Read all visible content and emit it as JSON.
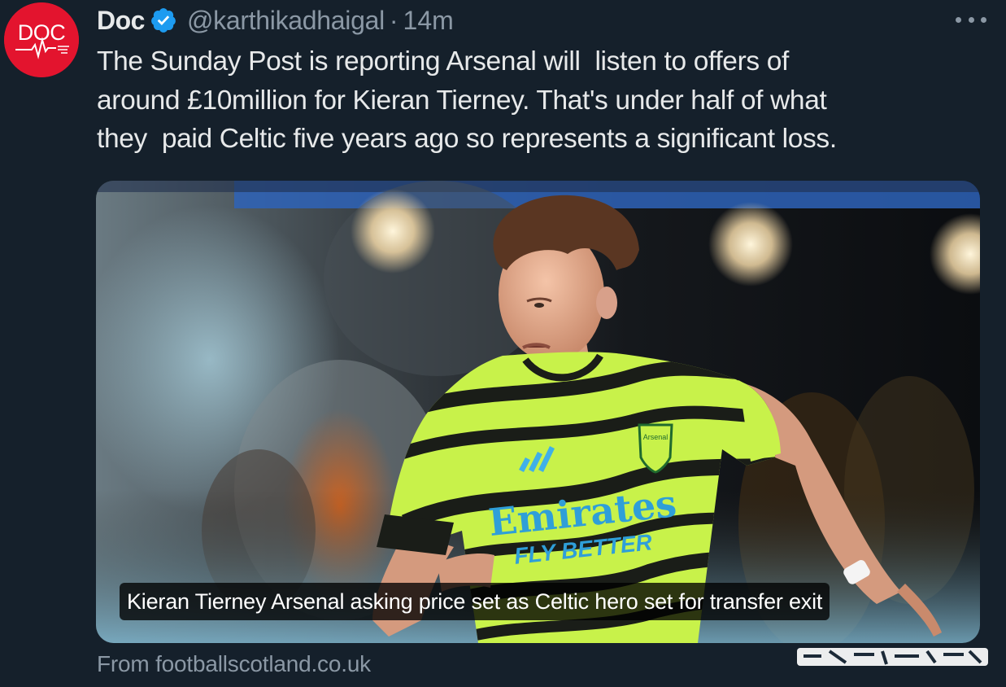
{
  "tweet": {
    "avatar": {
      "label": "DOC",
      "icon": "doc-logo-heartbeat-icon",
      "color": "#e3142e"
    },
    "author_name": "Doc",
    "verified_icon": "verified-badge-icon",
    "handle": "@karthikadhaigal",
    "separator": "·",
    "time": "14m",
    "more_icon": "more-options-icon",
    "text": "The Sunday Post is reporting Arsenal will  listen to offers of\naround £10million for Kieran Tierney. That's under half of what\nthey  paid Celtic five years ago so represents a significant loss.",
    "card": {
      "image": "footballer-in-arsenal-away-kit-photo",
      "shirt_sponsor": "Emirates",
      "shirt_tagline": "FLY BETTER",
      "crest_text": "Arsenal",
      "caption": "Kieran Tierney Arsenal asking price set as Celtic hero set for transfer exit"
    },
    "source": "From footballscotland.co.uk"
  },
  "colors": {
    "background": "#15202b",
    "text_primary": "#e7e9ea",
    "text_secondary": "#8b98a5",
    "verified": "#1d9bf0",
    "kit_yellow": "#c8f24a"
  }
}
